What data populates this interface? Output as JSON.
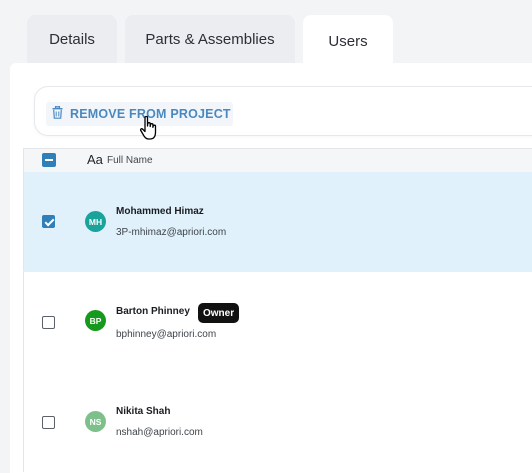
{
  "tabs": [
    {
      "label": "Details",
      "active": false
    },
    {
      "label": "Parts & Assemblies",
      "active": false
    },
    {
      "label": "Users",
      "active": true
    }
  ],
  "toolbar": {
    "remove_label": "REMOVE FROM PROJECT",
    "remove_icon": "trash-icon"
  },
  "table": {
    "header": {
      "type_glyph": "Aa",
      "column_label": "Full Name",
      "select_all_state": "indeterminate"
    },
    "rows": [
      {
        "initials": "MH",
        "name": "Mohammed Himaz",
        "email": "3P-mhimaz@apriori.com",
        "checked": true,
        "avatar_color": "#1aa39b",
        "badge": ""
      },
      {
        "initials": "BP",
        "name": "Barton Phinney",
        "email": "bphinney@apriori.com",
        "checked": false,
        "avatar_color": "#169a1e",
        "badge": "Owner"
      },
      {
        "initials": "NS",
        "name": "Nikita Shah",
        "email": "nshah@apriori.com",
        "checked": false,
        "avatar_color": "#7ec08b",
        "badge": ""
      }
    ]
  },
  "colors": {
    "accent": "#2f7fb8",
    "remove_text": "#4a89c0",
    "selected_row": "#e1f1fc"
  }
}
